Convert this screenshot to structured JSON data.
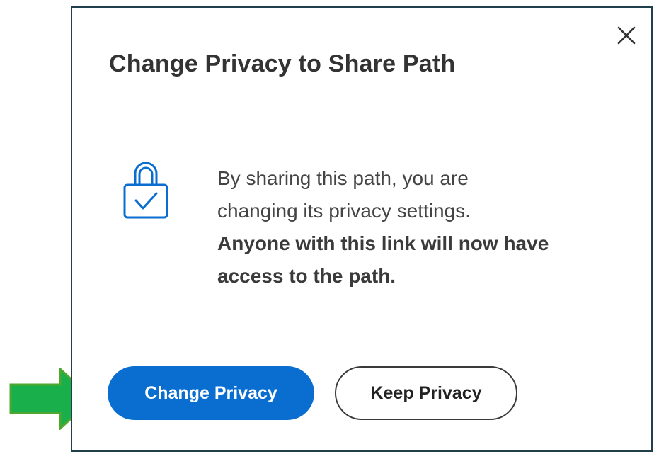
{
  "dialog": {
    "title": "Change Privacy to Share Path",
    "close_icon": "close-icon",
    "lock_icon": "lock-check-icon",
    "message_line1": "By sharing this path, you are",
    "message_line2": "changing its privacy settings.",
    "message_strong1": "Anyone with this link will now have",
    "message_strong2": "access to the path.",
    "primary_button": "Change Privacy",
    "secondary_button": "Keep Privacy"
  },
  "annotation": {
    "arrow_icon": "green-arrow-right-icon"
  },
  "colors": {
    "primary": "#0a6ed1",
    "icon_blue": "#0a6ed1",
    "border": "#1f3f4a",
    "arrow_fill": "#19b04b",
    "arrow_stroke": "#4ea72e"
  }
}
